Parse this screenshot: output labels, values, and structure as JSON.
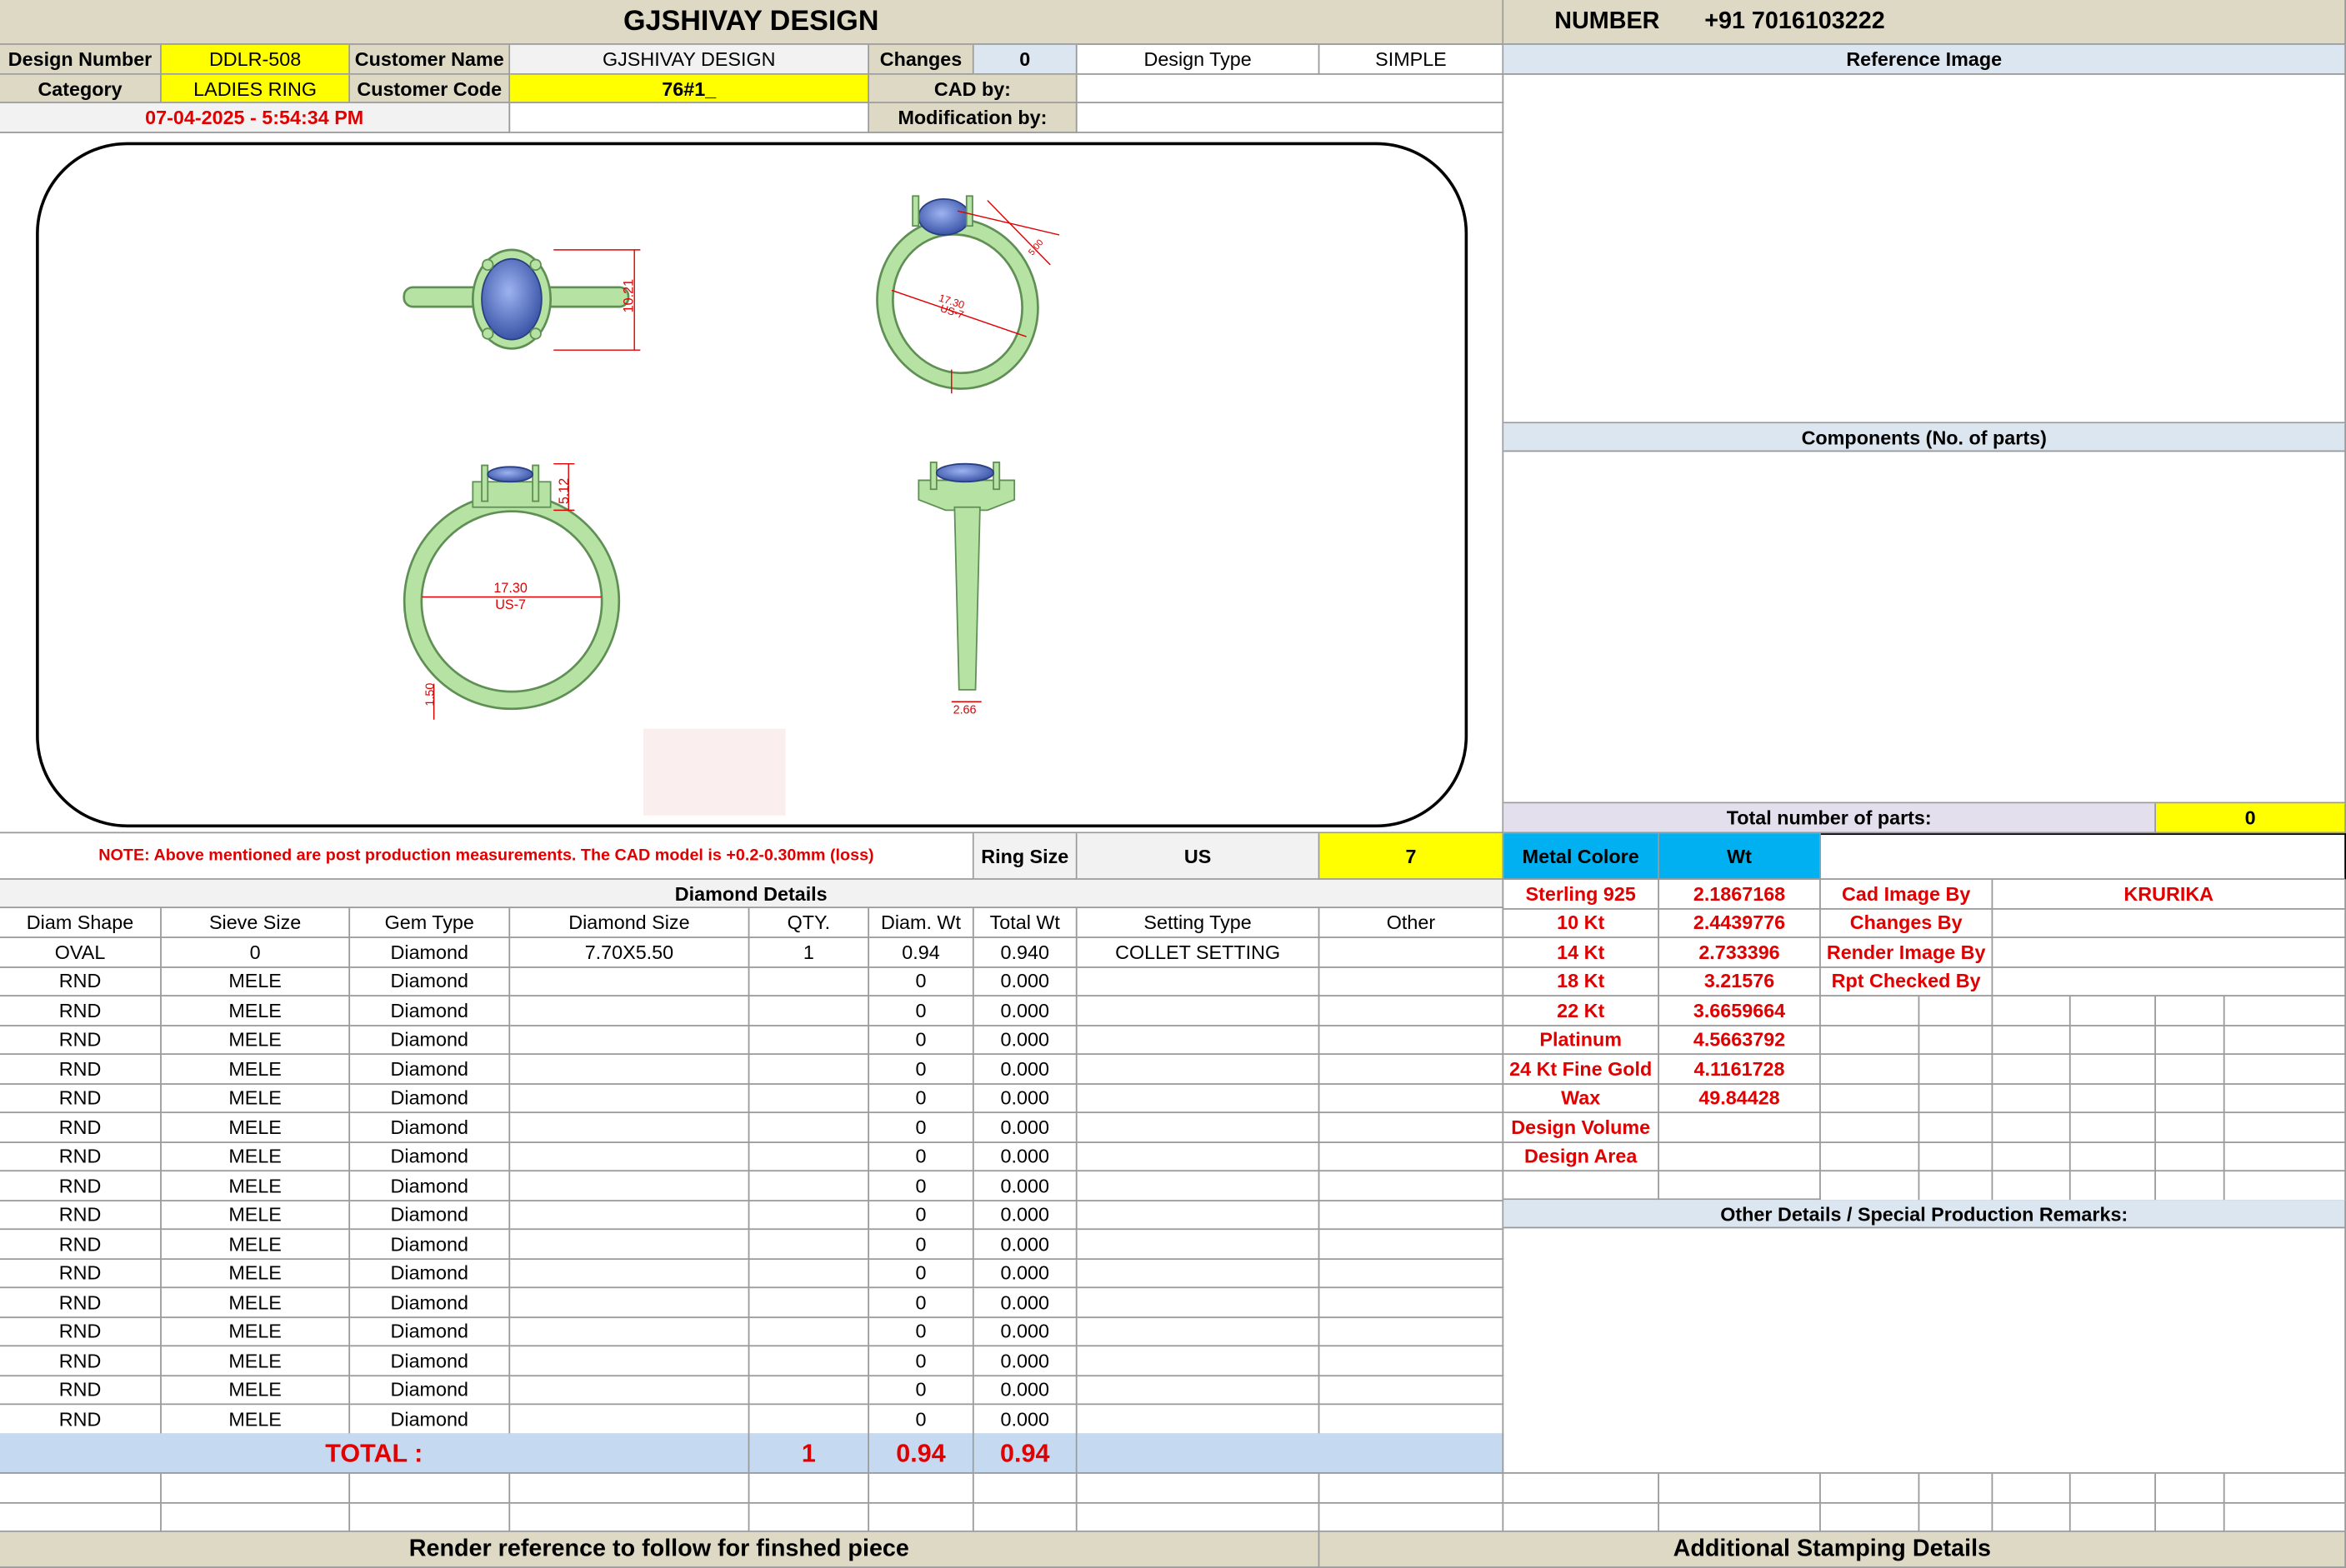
{
  "title": "GJSHIVAY DESIGN",
  "number_label": "NUMBER",
  "number_value": "+91 7016103222",
  "header": {
    "design_number_label": "Design Number",
    "design_number": "DDLR-508",
    "customer_name_label": "Customer Name",
    "customer_name": "GJSHIVAY DESIGN",
    "changes_label": "Changes",
    "changes": "0",
    "design_type_label": "Design Type",
    "design_type": "SIMPLE",
    "category_label": "Category",
    "category": "LADIES RING",
    "customer_code_label": "Customer Code",
    "customer_code": "76#1_",
    "cad_by_label": "CAD by:",
    "date": "07-04-2025 - 5:54:34 PM",
    "modification_by_label": "Modification by:"
  },
  "right_panel": {
    "reference_image": "Reference Image",
    "components": "Components (No. of parts)",
    "total_parts_label": "Total number of parts:",
    "total_parts": "0",
    "other_details": "Other Details / Special Production Remarks:"
  },
  "drawing_labels": {
    "top_height": "10.21",
    "front_height": "5.12",
    "front_diameter": "17.30",
    "front_size": "US-7",
    "front_band": "1.50",
    "side_width": "2.66",
    "persp_diameter": "17.30",
    "persp_size": "US-7",
    "persp_dim": "5.00"
  },
  "note": "NOTE: Above mentioned are post production measurements. The CAD model is +0.2-0.30mm (loss)",
  "ring_size_label": "Ring Size",
  "ring_size_unit": "US",
  "ring_size": "7",
  "metal": {
    "header_label": "Metal Colore",
    "header_wt": "Wt",
    "rows": [
      {
        "name": "Sterling 925",
        "wt": "2.1867168"
      },
      {
        "name": "10 Kt",
        "wt": "2.4439776"
      },
      {
        "name": "14 Kt",
        "wt": "2.733396"
      },
      {
        "name": "18 Kt",
        "wt": "3.21576"
      },
      {
        "name": "22 Kt",
        "wt": "3.6659664"
      },
      {
        "name": "Platinum",
        "wt": "4.5663792"
      },
      {
        "name": "24 Kt Fine Gold",
        "wt": "4.1161728"
      },
      {
        "name": "Wax",
        "wt": "49.84428"
      },
      {
        "name": "Design Volume",
        "wt": ""
      },
      {
        "name": "Design Area",
        "wt": ""
      }
    ]
  },
  "credits": [
    {
      "label": "Cad Image By",
      "value": "KRURIKA"
    },
    {
      "label": "Changes By",
      "value": ""
    },
    {
      "label": "Render Image By",
      "value": ""
    },
    {
      "label": "Rpt Checked By",
      "value": ""
    }
  ],
  "diamond": {
    "title": "Diamond Details",
    "columns": [
      "Diam Shape",
      "Sieve Size",
      "Gem Type",
      "Diamond Size",
      "QTY.",
      "Diam. Wt",
      "Total Wt",
      "Setting Type",
      "Other"
    ],
    "rows": [
      [
        "OVAL",
        "0",
        "Diamond",
        "7.70X5.50",
        "1",
        "0.94",
        "0.940",
        "COLLET SETTING",
        ""
      ],
      [
        "RND",
        "MELE",
        "Diamond",
        "",
        "",
        "0",
        "0.000",
        "",
        ""
      ],
      [
        "RND",
        "MELE",
        "Diamond",
        "",
        "",
        "0",
        "0.000",
        "",
        ""
      ],
      [
        "RND",
        "MELE",
        "Diamond",
        "",
        "",
        "0",
        "0.000",
        "",
        ""
      ],
      [
        "RND",
        "MELE",
        "Diamond",
        "",
        "",
        "0",
        "0.000",
        "",
        ""
      ],
      [
        "RND",
        "MELE",
        "Diamond",
        "",
        "",
        "0",
        "0.000",
        "",
        ""
      ],
      [
        "RND",
        "MELE",
        "Diamond",
        "",
        "",
        "0",
        "0.000",
        "",
        ""
      ],
      [
        "RND",
        "MELE",
        "Diamond",
        "",
        "",
        "0",
        "0.000",
        "",
        ""
      ],
      [
        "RND",
        "MELE",
        "Diamond",
        "",
        "",
        "0",
        "0.000",
        "",
        ""
      ],
      [
        "RND",
        "MELE",
        "Diamond",
        "",
        "",
        "0",
        "0.000",
        "",
        ""
      ],
      [
        "RND",
        "MELE",
        "Diamond",
        "",
        "",
        "0",
        "0.000",
        "",
        ""
      ],
      [
        "RND",
        "MELE",
        "Diamond",
        "",
        "",
        "0",
        "0.000",
        "",
        ""
      ],
      [
        "RND",
        "MELE",
        "Diamond",
        "",
        "",
        "0",
        "0.000",
        "",
        ""
      ],
      [
        "RND",
        "MELE",
        "Diamond",
        "",
        "",
        "0",
        "0.000",
        "",
        ""
      ],
      [
        "RND",
        "MELE",
        "Diamond",
        "",
        "",
        "0",
        "0.000",
        "",
        ""
      ],
      [
        "RND",
        "MELE",
        "Diamond",
        "",
        "",
        "0",
        "0.000",
        "",
        ""
      ],
      [
        "RND",
        "MELE",
        "Diamond",
        "",
        "",
        "0",
        "0.000",
        "",
        ""
      ]
    ],
    "total_label": "TOTAL :",
    "total_qty": "1",
    "total_diam_wt": "0.94",
    "total_wt": "0.94"
  },
  "footer_left": "Render reference to follow for finshed piece",
  "footer_right": "Additional Stamping Details",
  "colors": {
    "header_tan": "#ddd9c4",
    "highlight_yellow": "#ffff00",
    "light_blue": "#dce6f1",
    "total_blue": "#c5d9f1",
    "metal_header_cyan": "#00b0f0",
    "ring_metal": "#b6e3a4",
    "gem_blue": "#5a78c8",
    "dimension_red": "#e00000"
  }
}
